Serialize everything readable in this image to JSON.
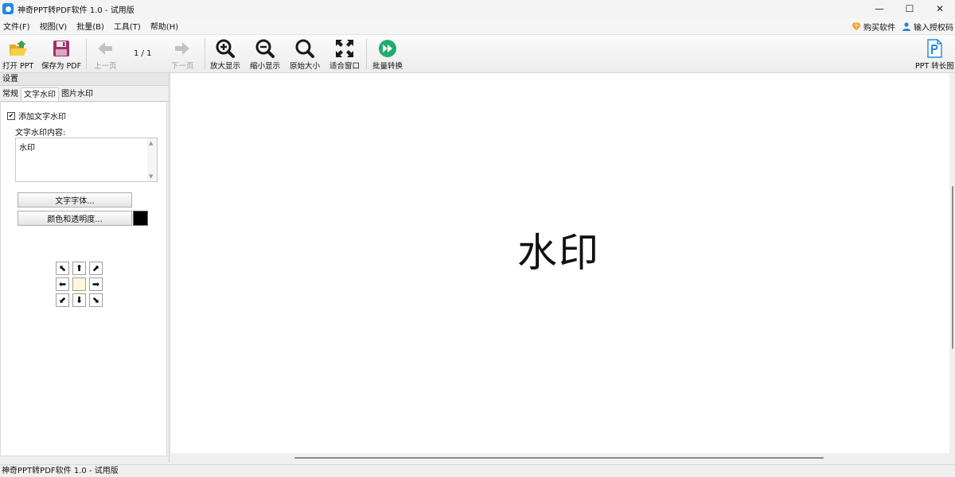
{
  "window": {
    "title": "神奇PPT转PDF软件 1.0 - 试用版",
    "controls": {
      "minimize": "—",
      "maximize": "☐",
      "close": "✕"
    }
  },
  "menu": {
    "items": [
      "文件(F)",
      "视图(V)",
      "批量(B)",
      "工具(T)",
      "帮助(H)"
    ],
    "buy": "购买软件",
    "license": "输入授权码"
  },
  "toolbar": {
    "open": "打开 PPT",
    "save_pdf": "保存为 PDF",
    "prev": "上一页",
    "page_info": "1 / 1",
    "next": "下一页",
    "zoom_in": "放大显示",
    "zoom_out": "缩小显示",
    "original": "原始大小",
    "fit": "适合窗口",
    "batch": "批量转换",
    "long_image": "PPT 转长图"
  },
  "settings": {
    "title": "设置",
    "tabs": [
      "常规",
      "文字水印",
      "图片水印"
    ],
    "active_tab": "文字水印",
    "add_text_watermark": "添加文字水印",
    "add_text_watermark_checked": true,
    "content_label": "文字水印内容:",
    "content_value": "水印",
    "font_button": "文字字体...",
    "color_button": "颜色和透明度...",
    "color": "#000000",
    "position_arrows": [
      "⬉",
      "⬆",
      "⬈",
      "⬅",
      "",
      "➡",
      "⬋",
      "⬇",
      "⬊"
    ]
  },
  "preview": {
    "watermark_text": "水印"
  },
  "status": {
    "text": "神奇PPT转PDF软件 1.0 - 试用版"
  }
}
